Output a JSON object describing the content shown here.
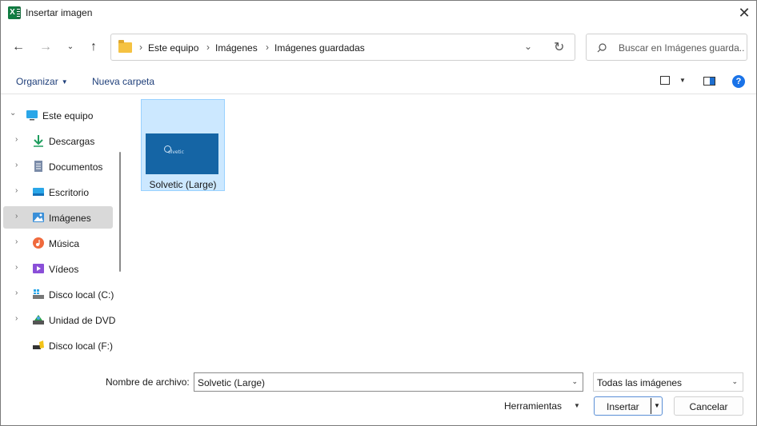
{
  "window": {
    "title": "Insertar imagen",
    "close_glyph": "✕"
  },
  "nav": {
    "back_glyph": "←",
    "forward_glyph": "→",
    "recent_glyph": "⌄",
    "up_glyph": "↑"
  },
  "address": {
    "separator": "›",
    "crumbs": [
      "Este equipo",
      "Imágenes",
      "Imágenes guardadas"
    ],
    "dropdown_glyph": "⌄",
    "refresh_glyph": "↻"
  },
  "search": {
    "placeholder": "Buscar en Imágenes guarda..."
  },
  "commands": {
    "organize": "Organizar",
    "new_folder": "Nueva carpeta",
    "caret": "▼",
    "help": "?"
  },
  "sidebar": {
    "items": [
      {
        "label": "Este equipo",
        "icon": "computer-icon"
      },
      {
        "label": "Descargas",
        "icon": "download-icon"
      },
      {
        "label": "Documentos",
        "icon": "document-icon"
      },
      {
        "label": "Escritorio",
        "icon": "desktop-icon"
      },
      {
        "label": "Imágenes",
        "icon": "pictures-icon",
        "selected": true
      },
      {
        "label": "Música",
        "icon": "music-icon"
      },
      {
        "label": "Vídeos",
        "icon": "video-icon"
      },
      {
        "label": "Disco local (C:)",
        "icon": "drive-icon"
      },
      {
        "label": "Unidad de DVD",
        "icon": "dvd-icon"
      },
      {
        "label": "Disco local (F:)",
        "icon": "usb-drive-icon"
      }
    ],
    "chevron_closed": "›",
    "chevron_open": "⌄"
  },
  "files": [
    {
      "name": "Solvetic (Large)",
      "thumb_text": "olvetic"
    }
  ],
  "footer": {
    "filename_label": "Nombre de archivo:",
    "filename_value": "Solvetic (Large)",
    "filter_value": "Todas las imágenes",
    "tools_label": "Herramientas",
    "insert_label": "Insertar",
    "cancel_label": "Cancelar",
    "caret": "⌄",
    "small_caret": "▼"
  },
  "colors": {
    "accent": "#1a73e8",
    "selection": "#cce8ff",
    "excel_green": "#107c41"
  }
}
